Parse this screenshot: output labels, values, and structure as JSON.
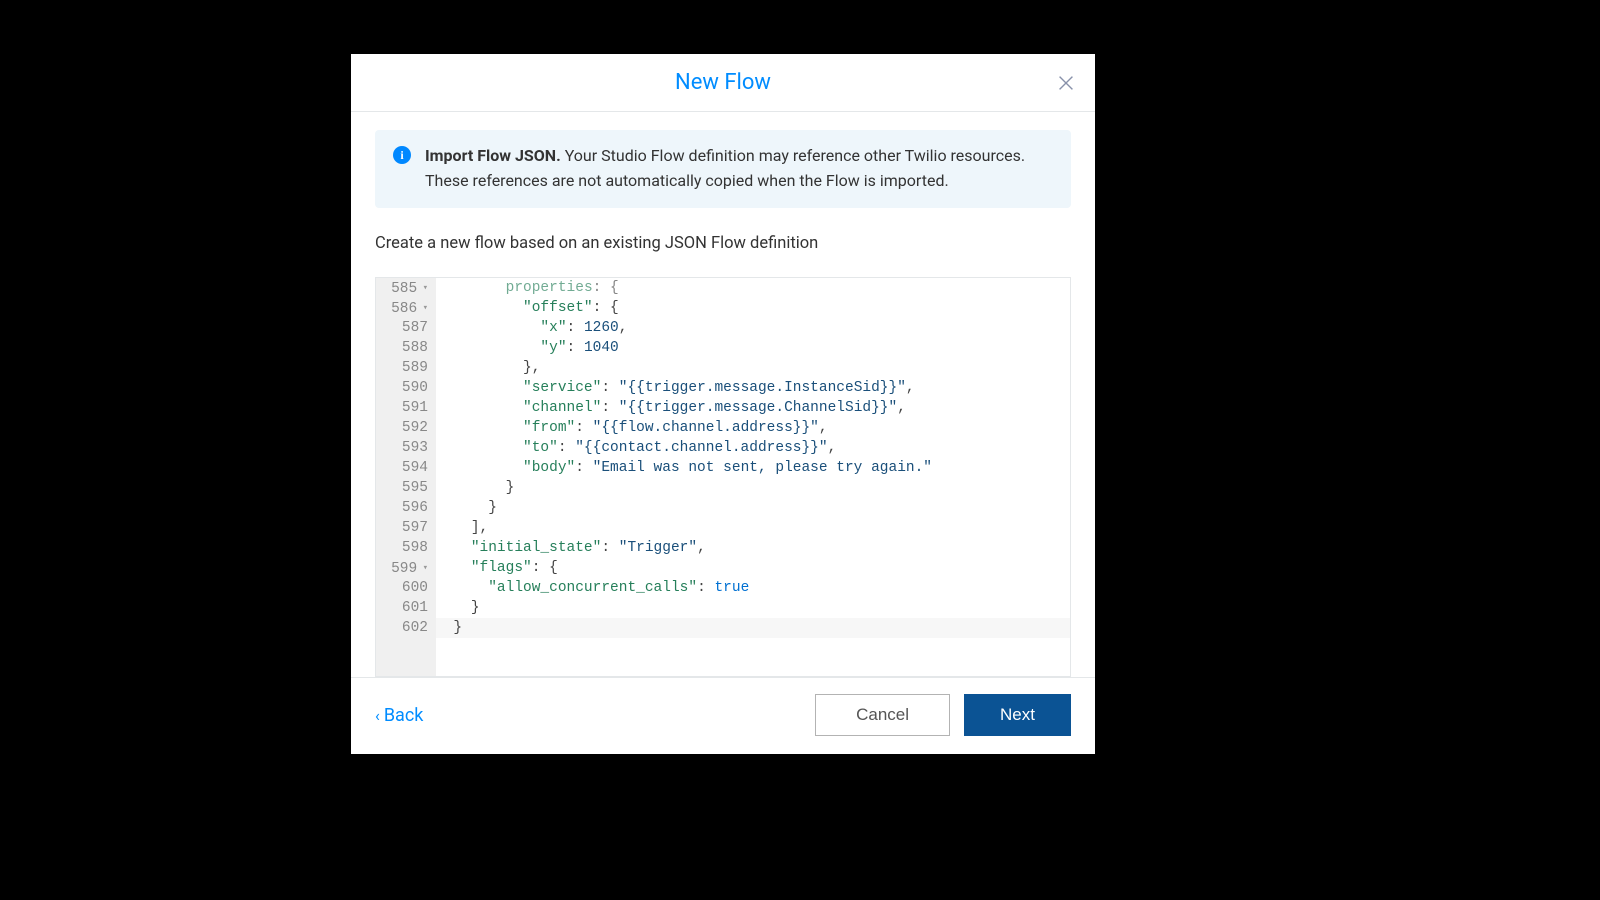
{
  "modal": {
    "title": "New Flow",
    "info_heading": "Import Flow JSON.",
    "info_body": " Your Studio Flow definition may reference other Twilio resources. These references are not automatically copied when the Flow is imported.",
    "description": "Create a new flow based on an existing JSON Flow definition"
  },
  "buttons": {
    "back": "Back",
    "cancel": "Cancel",
    "next": "Next"
  },
  "editor": {
    "lines": [
      {
        "num": "585",
        "fold": true
      },
      {
        "num": "586",
        "fold": true
      },
      {
        "num": "587"
      },
      {
        "num": "588"
      },
      {
        "num": "589"
      },
      {
        "num": "590"
      },
      {
        "num": "591"
      },
      {
        "num": "592"
      },
      {
        "num": "593"
      },
      {
        "num": "594"
      },
      {
        "num": "595"
      },
      {
        "num": "596"
      },
      {
        "num": "597"
      },
      {
        "num": "598"
      },
      {
        "num": "599",
        "fold": true
      },
      {
        "num": "600"
      },
      {
        "num": "601"
      },
      {
        "num": "602"
      }
    ],
    "code": {
      "l585": {
        "indent": "        ",
        "key": "properties",
        "tail": ": {"
      },
      "l586": {
        "indent": "          ",
        "key": "\"offset\"",
        "tail": ": {"
      },
      "l587": {
        "indent": "            ",
        "key": "\"x\"",
        "val": "1260",
        "tail": ","
      },
      "l588": {
        "indent": "            ",
        "key": "\"y\"",
        "val": "1040",
        "tail": ""
      },
      "l589": {
        "indent": "          ",
        "text": "},"
      },
      "l590": {
        "indent": "          ",
        "key": "\"service\"",
        "val": "\"{{trigger.message.InstanceSid}}\"",
        "tail": ","
      },
      "l591": {
        "indent": "          ",
        "key": "\"channel\"",
        "val": "\"{{trigger.message.ChannelSid}}\"",
        "tail": ","
      },
      "l592": {
        "indent": "          ",
        "key": "\"from\"",
        "val": "\"{{flow.channel.address}}\"",
        "tail": ","
      },
      "l593": {
        "indent": "          ",
        "key": "\"to\"",
        "val": "\"{{contact.channel.address}}\"",
        "tail": ","
      },
      "l594": {
        "indent": "          ",
        "key": "\"body\"",
        "val": "\"Email was not sent, please try again.\"",
        "tail": ""
      },
      "l595": {
        "indent": "        ",
        "text": "}"
      },
      "l596": {
        "indent": "      ",
        "text": "}"
      },
      "l597": {
        "indent": "    ",
        "text": "],"
      },
      "l598": {
        "indent": "    ",
        "key": "\"initial_state\"",
        "val": "\"Trigger\"",
        "tail": ","
      },
      "l599": {
        "indent": "    ",
        "key": "\"flags\"",
        "tail": ": {"
      },
      "l600": {
        "indent": "      ",
        "key": "\"allow_concurrent_calls\"",
        "val": "true",
        "tail": ""
      },
      "l601": {
        "indent": "    ",
        "text": "}"
      },
      "l602": {
        "indent": "  ",
        "text": "}"
      }
    }
  }
}
